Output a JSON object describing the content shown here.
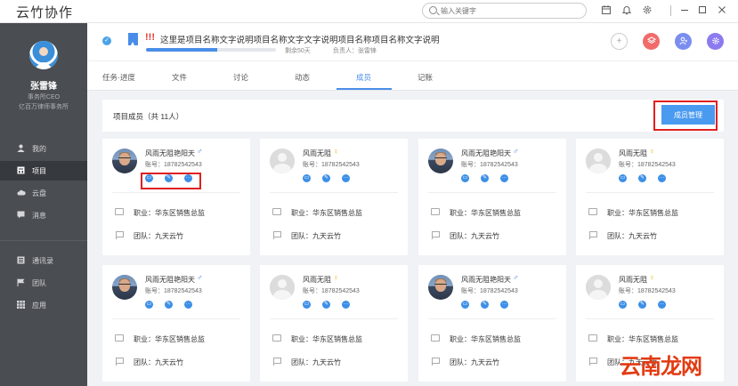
{
  "app": {
    "title": "云竹协作"
  },
  "search": {
    "placeholder": "输入关键字"
  },
  "sidebar": {
    "user_name": "张雷锋",
    "user_role": "事务所CEO",
    "user_org": "亿百万律师事务所",
    "items": [
      {
        "label": "我的",
        "icon": "person-icon"
      },
      {
        "label": "项目",
        "icon": "project-icon",
        "active": true
      },
      {
        "label": "云盘",
        "icon": "cloud-icon"
      },
      {
        "label": "消息",
        "icon": "message-icon"
      },
      {
        "label": "通讯录",
        "icon": "contacts-icon"
      },
      {
        "label": "团队",
        "icon": "flag-icon"
      },
      {
        "label": "应用",
        "icon": "apps-icon"
      }
    ]
  },
  "project": {
    "priority": "!!!",
    "name": "这里是项目名称文字说明项目名称文字文字说明项目名称项目名称文字说明",
    "progress": 0.55,
    "remaining": "剩余50天",
    "owner": "负责人：张雷锋"
  },
  "tabs": [
    {
      "label": "任务·进度"
    },
    {
      "label": "文件"
    },
    {
      "label": "讨论"
    },
    {
      "label": "动态"
    },
    {
      "label": "成员",
      "active": true
    },
    {
      "label": "记账"
    }
  ],
  "members": {
    "title": "项目成员（共 11人）",
    "manage_label": "成员管理",
    "cards": [
      {
        "name": "风雨无阻艳阳天",
        "gender": "male",
        "account": "账号：18782542543",
        "job": "职业：华东区销售总监",
        "team": "团队：九天云竹",
        "photo": true
      },
      {
        "name": "风雨无阻",
        "gender": "female",
        "account": "账号：18782542543",
        "job": "职业：华东区销售总监",
        "team": "团队：九天云竹",
        "photo": false
      },
      {
        "name": "风雨无阻艳阳天",
        "gender": "male",
        "account": "账号：18782542543",
        "job": "职业：华东区销售总监",
        "team": "团队：九天云竹",
        "photo": true
      },
      {
        "name": "风雨无阻",
        "gender": "female",
        "account": "账号：18782542543",
        "job": "职业：华东区销售总监",
        "team": "团队：九天云竹",
        "photo": false
      },
      {
        "name": "风雨无阻艳阳天",
        "gender": "male",
        "account": "账号：18782542543",
        "job": "职业：华东区销售总监",
        "team": "团队：九天云竹",
        "photo": true
      },
      {
        "name": "风雨无阻",
        "gender": "female",
        "account": "账号：18782542543",
        "job": "职业：华东区销售总监",
        "team": "团队：九天云竹",
        "photo": false
      },
      {
        "name": "风雨无阻艳阳天",
        "gender": "male",
        "account": "账号：18782542543",
        "job": "职业：华东区销售总监",
        "team": "团队：九天云竹",
        "photo": true
      },
      {
        "name": "风雨无阻",
        "gender": "female",
        "account": "账号：18782542543",
        "job": "职业：华东区销售总监",
        "team": "团队：九天云竹",
        "photo": false
      }
    ]
  },
  "watermark": "云南龙网",
  "colors": {
    "accent": "#4a8de8",
    "sidebar": "#4a4d51",
    "highlight": "#e02020"
  }
}
